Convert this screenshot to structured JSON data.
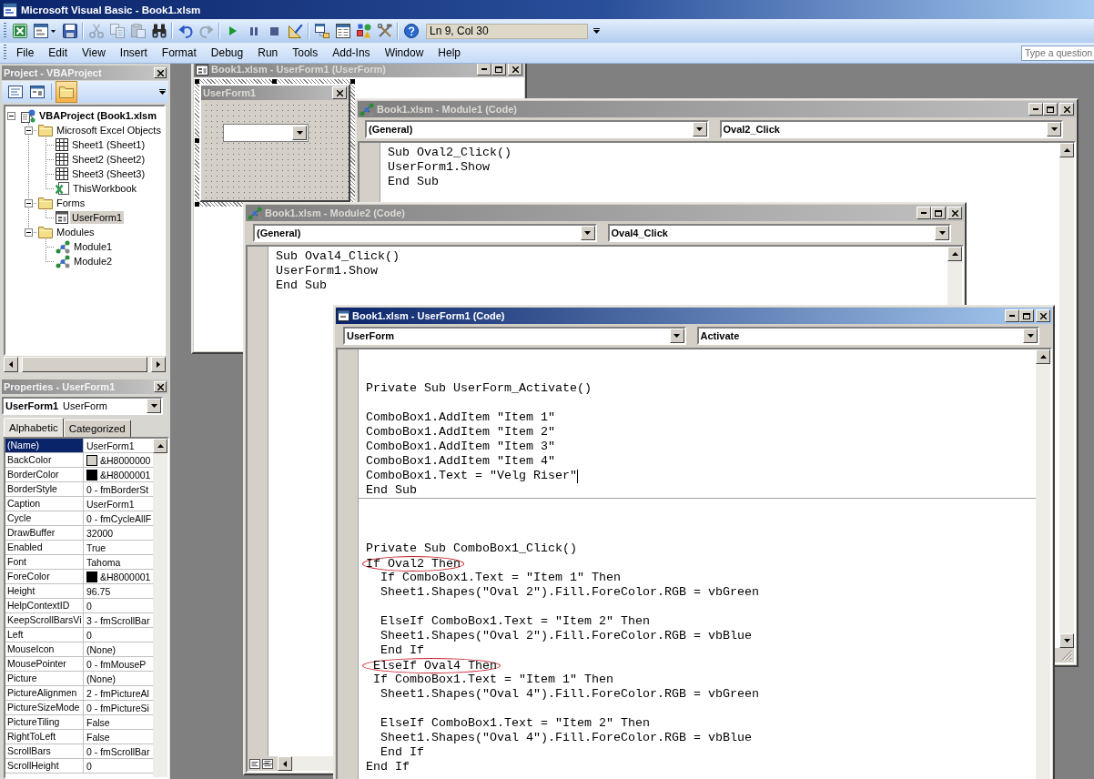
{
  "window": {
    "title": "Microsoft Visual Basic - Book1.xlsm"
  },
  "toolbar": {
    "buttons": [
      {
        "disabled": false
      },
      {
        "disabled": false
      },
      {
        "disabled": false
      },
      {
        "disabled": true
      },
      {
        "disabled": true
      },
      {
        "disabled": true
      },
      {
        "disabled": false
      },
      {
        "disabled": false
      },
      {
        "disabled": true
      },
      {
        "disabled": false
      },
      {
        "disabled": false
      },
      {
        "disabled": false
      },
      {
        "disabled": false
      },
      {
        "disabled": false
      },
      {
        "disabled": false
      },
      {
        "disabled": false
      },
      {
        "disabled": false
      },
      {
        "disabled": false
      }
    ],
    "position": "Ln 9, Col 30"
  },
  "menu": [
    "File",
    "Edit",
    "View",
    "Insert",
    "Format",
    "Debug",
    "Run",
    "Tools",
    "Add-Ins",
    "Window",
    "Help"
  ],
  "help_search": {
    "placeholder": "Type a question"
  },
  "project": {
    "title": "Project - VBAProject",
    "buttons": [
      {
        "pressed": false
      },
      {
        "pressed": false
      },
      {
        "pressed": true
      }
    ],
    "tree": [
      {
        "kind": "project",
        "label": "VBAProject (Book1.xlsm",
        "expanded": true,
        "selected": false,
        "children": [
          {
            "kind": "folder",
            "label": "Microsoft Excel Objects",
            "expanded": true,
            "selected": false,
            "children": [
              {
                "kind": "sheet",
                "label": "Sheet1 (Sheet1)",
                "selected": false
              },
              {
                "kind": "sheet",
                "label": "Sheet2 (Sheet2)",
                "selected": false
              },
              {
                "kind": "sheet",
                "label": "Sheet3 (Sheet3)",
                "selected": false
              },
              {
                "kind": "workbook",
                "label": "ThisWorkbook",
                "selected": false
              }
            ]
          },
          {
            "kind": "folder",
            "label": "Forms",
            "expanded": true,
            "selected": false,
            "children": [
              {
                "kind": "form",
                "label": "UserForm1",
                "selected": true
              }
            ]
          },
          {
            "kind": "folder",
            "label": "Modules",
            "expanded": true,
            "selected": false,
            "children": [
              {
                "kind": "module",
                "label": "Module1",
                "selected": false
              },
              {
                "kind": "module",
                "label": "Module2",
                "selected": false
              }
            ]
          }
        ]
      }
    ]
  },
  "properties": {
    "title": "Properties - UserForm1",
    "object": {
      "name": "UserForm1",
      "type": "UserForm"
    },
    "tabs": [
      {
        "label": "Alphabetic",
        "selected": true
      },
      {
        "label": "Categorized",
        "selected": false
      }
    ],
    "rows": [
      {
        "name": "(Name)",
        "value": "UserForm1",
        "selected": true
      },
      {
        "name": "BackColor",
        "value": "&H8000000",
        "color": "#d4d0c8",
        "selected": false
      },
      {
        "name": "BorderColor",
        "value": "&H8000001",
        "color": "#000000",
        "selected": false
      },
      {
        "name": "BorderStyle",
        "value": "0 - fmBorderSt",
        "selected": false
      },
      {
        "name": "Caption",
        "value": "UserForm1",
        "selected": false
      },
      {
        "name": "Cycle",
        "value": "0 - fmCycleAllF",
        "selected": false
      },
      {
        "name": "DrawBuffer",
        "value": "32000",
        "selected": false
      },
      {
        "name": "Enabled",
        "value": "True",
        "selected": false
      },
      {
        "name": "Font",
        "value": "Tahoma",
        "selected": false
      },
      {
        "name": "ForeColor",
        "value": "&H8000001",
        "color": "#000000",
        "selected": false
      },
      {
        "name": "Height",
        "value": "96.75",
        "selected": false
      },
      {
        "name": "HelpContextID",
        "value": "0",
        "selected": false
      },
      {
        "name": "KeepScrollBarsVi",
        "value": "3 - fmScrollBar",
        "selected": false
      },
      {
        "name": "Left",
        "value": "0",
        "selected": false
      },
      {
        "name": "MouseIcon",
        "value": "(None)",
        "selected": false
      },
      {
        "name": "MousePointer",
        "value": "0 - fmMouseP",
        "selected": false
      },
      {
        "name": "Picture",
        "value": "(None)",
        "selected": false
      },
      {
        "name": "PictureAlignmen",
        "value": "2 - fmPictureAl",
        "selected": false
      },
      {
        "name": "PictureSizeMode",
        "value": "0 - fmPictureSi",
        "selected": false
      },
      {
        "name": "PictureTiling",
        "value": "False",
        "selected": false
      },
      {
        "name": "RightToLeft",
        "value": "False",
        "selected": false
      },
      {
        "name": "ScrollBars",
        "value": "0 - fmScrollBar",
        "selected": false
      },
      {
        "name": "ScrollHeight",
        "value": "0",
        "selected": false
      }
    ]
  },
  "windows": [
    {
      "kind": "designer",
      "title": "Book1.xlsm - UserForm1 (UserForm)",
      "active": false,
      "form": {
        "caption": "UserForm1"
      }
    },
    {
      "kind": "module",
      "title": "Book1.xlsm - Module1 (Code)",
      "active": false,
      "object": "(General)",
      "procedure": "Oval2_Click",
      "procedures": [
        {
          "lines": [
            {
              "kind": "code",
              "text": "Sub Oval2_Click()",
              "circled": false,
              "caret": false
            },
            {
              "kind": "code",
              "text": "UserForm1.Show",
              "circled": false,
              "caret": false
            },
            {
              "kind": "code",
              "text": "End Sub",
              "circled": false,
              "caret": false
            }
          ]
        }
      ]
    },
    {
      "kind": "module",
      "title": "Book1.xlsm - Module2 (Code)",
      "active": false,
      "object": "(General)",
      "procedure": "Oval4_Click",
      "procedures": [
        {
          "lines": [
            {
              "kind": "code",
              "text": "Sub Oval4_Click()",
              "circled": false,
              "caret": false
            },
            {
              "kind": "code",
              "text": "UserForm1.Show",
              "circled": false,
              "caret": false
            },
            {
              "kind": "code",
              "text": "End Sub",
              "circled": false,
              "caret": false
            }
          ]
        }
      ]
    },
    {
      "kind": "formcode",
      "title": "Book1.xlsm - UserForm1 (Code)",
      "active": true,
      "object": "UserForm",
      "procedure": "Activate",
      "procedures": [
        {
          "lines": [
            {
              "kind": "blank",
              "circled": false,
              "caret": false
            },
            {
              "kind": "blank",
              "circled": false,
              "caret": false
            },
            {
              "kind": "code",
              "text": "Private Sub UserForm_Activate()",
              "circled": false,
              "caret": false
            },
            {
              "kind": "blank",
              "circled": false,
              "caret": false
            },
            {
              "kind": "code",
              "text": "ComboBox1.AddItem \"Item 1\"",
              "circled": false,
              "caret": false
            },
            {
              "kind": "code",
              "text": "ComboBox1.AddItem \"Item 2\"",
              "circled": false,
              "caret": false
            },
            {
              "kind": "code",
              "text": "ComboBox1.AddItem \"Item 3\"",
              "circled": false,
              "caret": false
            },
            {
              "kind": "code",
              "text": "ComboBox1.AddItem \"Item 4\"",
              "circled": false,
              "caret": false
            },
            {
              "kind": "code",
              "text": "ComboBox1.Text = \"Velg Riser\"",
              "circled": false,
              "caret": true
            },
            {
              "kind": "code",
              "text": "End Sub",
              "circled": false,
              "caret": false
            }
          ]
        },
        {
          "lines": [
            {
              "kind": "blank",
              "circled": false,
              "caret": false
            },
            {
              "kind": "blank",
              "circled": false,
              "caret": false
            },
            {
              "kind": "blank",
              "circled": false,
              "caret": false
            },
            {
              "kind": "code",
              "text": "Private Sub ComboBox1_Click()",
              "circled": false,
              "caret": false
            },
            {
              "kind": "code",
              "text": "If Oval2 Then",
              "circled": true,
              "caret": false
            },
            {
              "kind": "code",
              "text": "  If ComboBox1.Text = \"Item 1\" Then",
              "circled": false,
              "caret": false
            },
            {
              "kind": "code",
              "text": "  Sheet1.Shapes(\"Oval 2\").Fill.ForeColor.RGB = vbGreen",
              "circled": false,
              "caret": false
            },
            {
              "kind": "blank",
              "circled": false,
              "caret": false
            },
            {
              "kind": "code",
              "text": "  ElseIf ComboBox1.Text = \"Item 2\" Then",
              "circled": false,
              "caret": false
            },
            {
              "kind": "code",
              "text": "  Sheet1.Shapes(\"Oval 2\").Fill.ForeColor.RGB = vbBlue",
              "circled": false,
              "caret": false
            },
            {
              "kind": "code",
              "text": "  End If",
              "circled": false,
              "caret": false
            },
            {
              "kind": "code",
              "text": " ElseIf Oval4 Then",
              "circled": true,
              "caret": false
            },
            {
              "kind": "code",
              "text": " If ComboBox1.Text = \"Item 1\" Then",
              "circled": false,
              "caret": false
            },
            {
              "kind": "code",
              "text": "  Sheet1.Shapes(\"Oval 4\").Fill.ForeColor.RGB = vbGreen",
              "circled": false,
              "caret": false
            },
            {
              "kind": "blank",
              "circled": false,
              "caret": false
            },
            {
              "kind": "code",
              "text": "  ElseIf ComboBox1.Text = \"Item 2\" Then",
              "circled": false,
              "caret": false
            },
            {
              "kind": "code",
              "text": "  Sheet1.Shapes(\"Oval 4\").Fill.ForeColor.RGB = vbBlue",
              "circled": false,
              "caret": false
            },
            {
              "kind": "code",
              "text": "  End If",
              "circled": false,
              "caret": false
            },
            {
              "kind": "code",
              "text": "End If",
              "circled": false,
              "caret": false
            }
          ]
        }
      ]
    }
  ]
}
